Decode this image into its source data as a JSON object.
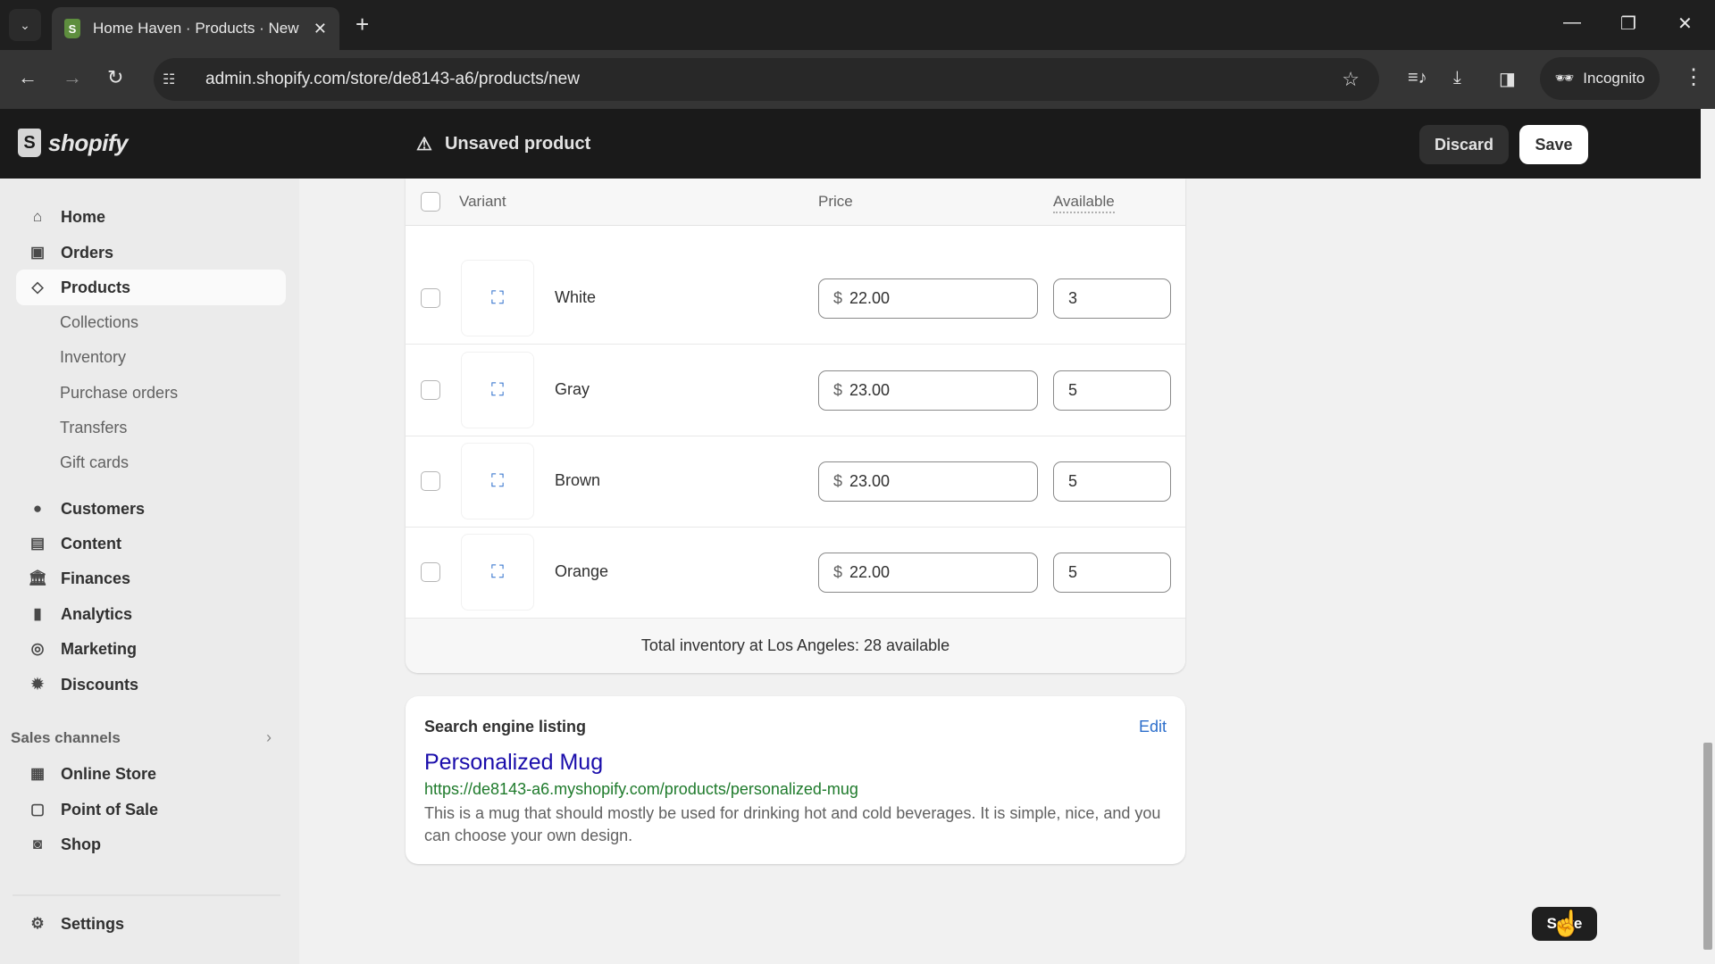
{
  "browser": {
    "tab_title": "Home Haven · Products · New ·",
    "url": "admin.shopify.com/store/de8143-a6/products/new",
    "incognito_label": "Incognito"
  },
  "topbar": {
    "logo_text": "shopify",
    "status": "Unsaved product",
    "discard_label": "Discard",
    "save_label": "Save"
  },
  "sidebar": {
    "items": [
      {
        "label": "Home",
        "icon": "home-icon"
      },
      {
        "label": "Orders",
        "icon": "inbox-icon"
      },
      {
        "label": "Products",
        "icon": "tag-icon",
        "active": true
      }
    ],
    "product_subitems": [
      "Collections",
      "Inventory",
      "Purchase orders",
      "Transfers",
      "Gift cards"
    ],
    "items2": [
      {
        "label": "Customers",
        "icon": "person-icon"
      },
      {
        "label": "Content",
        "icon": "content-icon"
      },
      {
        "label": "Finances",
        "icon": "bank-icon"
      },
      {
        "label": "Analytics",
        "icon": "bar-chart-icon"
      },
      {
        "label": "Marketing",
        "icon": "target-icon"
      },
      {
        "label": "Discounts",
        "icon": "discount-icon"
      }
    ],
    "sales_channels_label": "Sales channels",
    "channels": [
      {
        "label": "Online Store",
        "icon": "store-icon"
      },
      {
        "label": "Point of Sale",
        "icon": "pos-icon"
      },
      {
        "label": "Shop",
        "icon": "shop-icon"
      }
    ],
    "settings_label": "Settings"
  },
  "variants_table": {
    "headers": {
      "variant": "Variant",
      "price": "Price",
      "available": "Available"
    },
    "currency_symbol": "$",
    "rows": [
      {
        "name": "White",
        "price": "22.00",
        "available": "3"
      },
      {
        "name": "Gray",
        "price": "23.00",
        "available": "5"
      },
      {
        "name": "Brown",
        "price": "23.00",
        "available": "5"
      },
      {
        "name": "Orange",
        "price": "22.00",
        "available": "5"
      }
    ],
    "total_text": "Total inventory at Los Angeles: 28 available"
  },
  "seo": {
    "heading": "Search engine listing",
    "edit_label": "Edit",
    "title": "Personalized Mug",
    "url": "https://de8143-a6.myshopify.com/products/personalized-mug",
    "description": "This is a mug that should mostly be used for drinking hot and cold beverages. It is simple, nice, and you can choose your own design."
  },
  "floating_save_label": "Save",
  "colors": {
    "link_blue": "#2c6ecb",
    "seo_title": "#1a0dab",
    "seo_url": "#1e7a2b",
    "topbar_bg": "#1a1a1a"
  }
}
